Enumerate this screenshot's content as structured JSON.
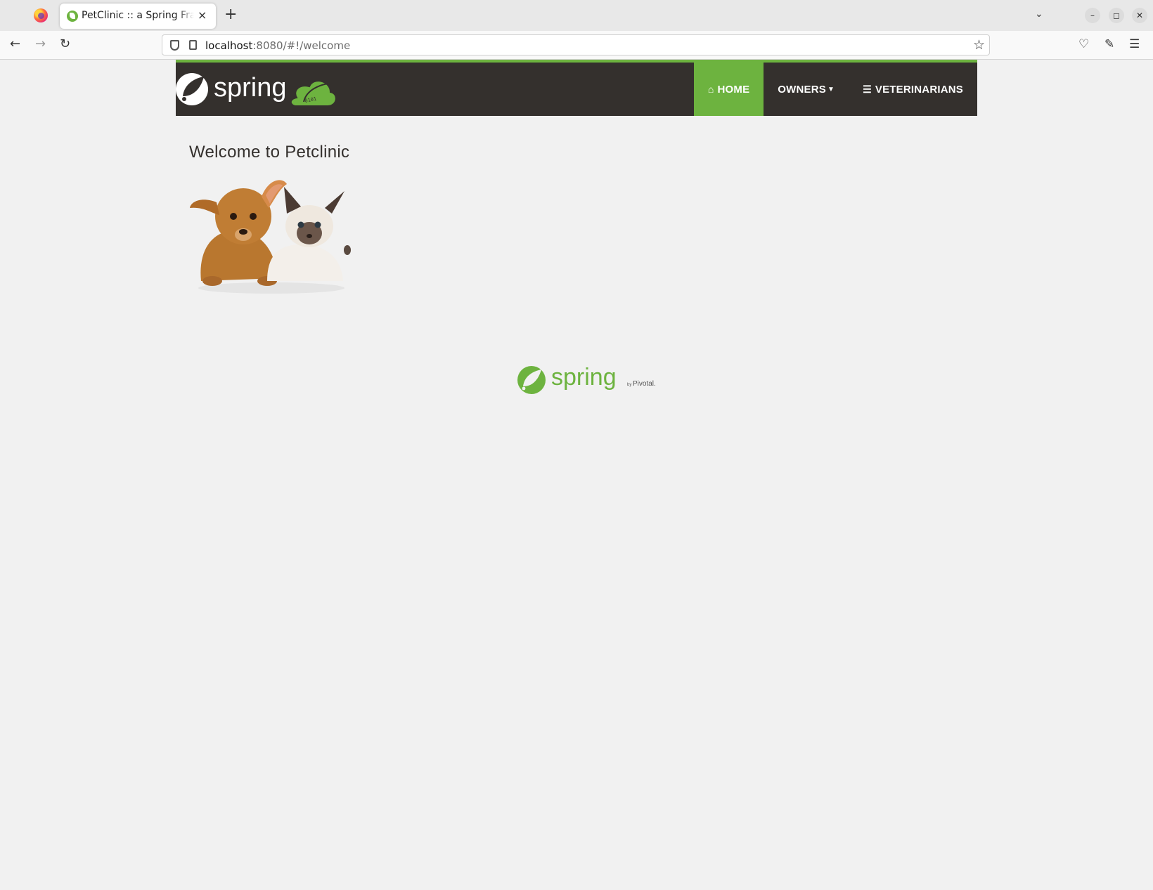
{
  "browser": {
    "tab_title": "PetClinic :: a Spring Framework demonstration",
    "tab_close": "×",
    "new_tab": "+",
    "url_host": "localhost",
    "url_rest": ":8080/#!/welcome"
  },
  "app": {
    "brand_text": "spring",
    "cloud_digits": "0101",
    "nav": {
      "home": "Home",
      "owners": "Owners",
      "veterinarians": "Veterinarians"
    },
    "welcome_heading": "Welcome to Petclinic",
    "footer_brand": "spring",
    "footer_by": "by",
    "footer_pivotal": "Pivotal."
  },
  "colors": {
    "spring_green": "#6db33f",
    "nav_dark": "#34302d",
    "page_bg": "#f1f1f1"
  },
  "icons": [
    "firefox-icon",
    "spring-favicon",
    "back-icon",
    "forward-icon",
    "reload-icon",
    "shield-icon",
    "page-icon",
    "bookmark-star-icon",
    "pocket-icon",
    "extensions-icon",
    "menu-icon",
    "home-icon",
    "caret-down-icon",
    "list-icon"
  ]
}
